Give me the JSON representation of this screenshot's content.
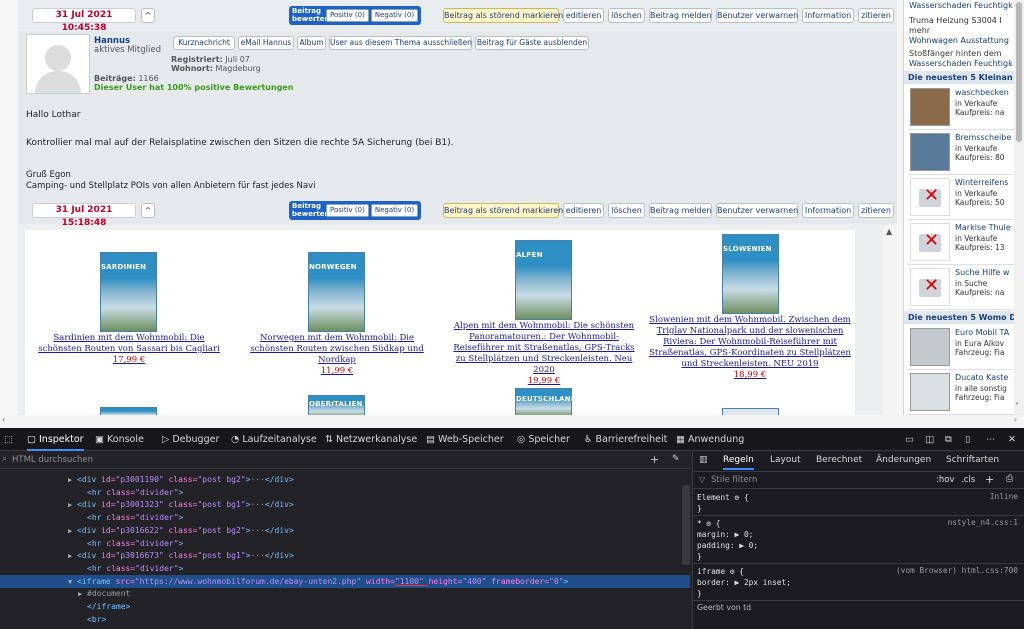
{
  "post1_bar": {
    "date": "31 Jul 2021 10:45:38",
    "up": "^",
    "rate_label": "Beitrag bewerten:",
    "positive": "Positiv (0)",
    "negative": "Negativ (0)",
    "actions": [
      "Beitrag als störend markieren",
      "editieren",
      "löschen",
      "Beitrag melden",
      "Benutzer verwarnen",
      "Information",
      "zitieren"
    ]
  },
  "post2": {
    "user": "Hannus",
    "role": "aktives Mitglied",
    "user_buttons": [
      "Kurznachricht",
      "eMail Hannus",
      "Album",
      "User aus diesem Thema ausschließen",
      "Beitrag für Gäste ausblenden"
    ],
    "registered_label": "Registriert:",
    "registered": "Juli 07",
    "location_label": "Wohnort:",
    "location": "Magdeburg",
    "posts_label": "Beiträge:",
    "posts": "1166",
    "rating": "Dieser User hat 100% positive Bewertungen",
    "body": [
      "Hallo Lothar",
      "Kontrollier mal mal auf der Relaisplatine zwischen den Sitzen die rechte 5A Sicherung (bei B1).",
      "Gruß Egon",
      "Camping- und Stellplatz POIs von allen Anbietern für fast jedes Navi"
    ]
  },
  "post2_bar": {
    "date": "31 Jul 2021 15:18:48",
    "up": "^",
    "rate_label": "Beitrag bewerten:",
    "positive": "Positiv (0)",
    "negative": "Negativ (0)",
    "actions": [
      "Beitrag als störend markieren",
      "editieren",
      "löschen",
      "Beitrag melden",
      "Benutzer verwarnen",
      "Information",
      "zitieren"
    ]
  },
  "ad": {
    "books": [
      {
        "cover": "SARDINIEN",
        "title": "Sardinien mit dem Wohnmobil: Die schönsten Routen von Sassari bis Cagliari",
        "price": "17,99 €"
      },
      {
        "cover": "NORWEGEN",
        "title": "Norwegen mit dem Wohnmobil: Die schönsten Routen zwischen Südkap und Nordkap",
        "price": "11,99 €"
      },
      {
        "cover": "ALPEN",
        "title": "Alpen mit dem Wohnmobil: Die schönsten Panoramatouren.: Der Wohnmobil-Reiseführer mit Straßenatlas, GPS-Tracks zu Stellplätzen und Streckenleisten. Neu 2020",
        "price": "19,99 €"
      },
      {
        "cover": "SLOWENIEN",
        "title": "Slowenien mit dem Wohnmobil. Zwischen dem Triglav Nationalpark und der slowenischen Riviera: Der Wohnmobil-Reiseführer mit Straßenatlas, GPS-Koordinaten zu Stellplätzen und Streckenleisten. NEU 2019",
        "price": "18,99 €"
      }
    ],
    "covers_row2": [
      "OBERITALIEN",
      "DEUTSCHLAND"
    ]
  },
  "sidebar": {
    "top": [
      "Wasserschaden Feuchtigk",
      "Truma Heizung S3004 I",
      "mehr",
      "Wohnwagen Ausstattung",
      "Stoßfänger hinten dem",
      "Wasserschaden Feuchtigk"
    ],
    "kleinanz_head": "Die neuesten 5 Kleinan",
    "kleinanz": [
      {
        "t1": "waschbecken",
        "t2": "in Verkaufe",
        "t3": "Kaufpreis: na"
      },
      {
        "t1": "Bremsscheibe",
        "t2": "in Verkaufe",
        "t3": "Kaufpreis: 80"
      },
      {
        "t1": "Winterreifens",
        "t2": "in Verkaufe",
        "t3": "Kaufpreis: 50"
      },
      {
        "t1": "Markise Thule",
        "t2": "in Verkaufe",
        "t3": "Kaufpreis: 13"
      },
      {
        "t1": "Suche Hilfe w",
        "t2": "in Suche",
        "t3": "Kaufpreis: na"
      }
    ],
    "womo_head": "Die neuesten 5 Womo D",
    "womo": [
      {
        "t1": "Euro Mobil TA",
        "t2": "in Eura Alkov",
        "t3": "Fahrzeug: Fia"
      },
      {
        "t1": "Ducato Kaste",
        "t2": "in alle sonstig",
        "t3": "Fahrzeug: Fia"
      }
    ]
  },
  "devtools": {
    "tabs": [
      "Inspektor",
      "Konsole",
      "Debugger",
      "Laufzeitanalyse",
      "Netzwerkanalyse",
      "Web-Speicher",
      "Speicher",
      "Barrierefreiheit",
      "Anwendung"
    ],
    "search_placeholder": "HTML durchsuchen",
    "code": [
      {
        "indent": 68,
        "arrow": "▶",
        "parts": [
          [
            "tg",
            "<div "
          ],
          [
            "at",
            "id="
          ],
          [
            "av",
            "\"p3001190\" "
          ],
          [
            "at",
            "class="
          ],
          [
            "av",
            "\"post bg2\""
          ],
          [
            "tg",
            ">"
          ],
          [
            "cm",
            "···"
          ],
          [
            "tg",
            "</div>"
          ]
        ]
      },
      {
        "indent": 78,
        "arrow": "",
        "parts": [
          [
            "tg",
            "<hr "
          ],
          [
            "at",
            "class="
          ],
          [
            "av",
            "\"divider\""
          ],
          [
            "tg",
            ">"
          ]
        ]
      },
      {
        "indent": 68,
        "arrow": "▶",
        "parts": [
          [
            "tg",
            "<div "
          ],
          [
            "at",
            "id="
          ],
          [
            "av",
            "\"p3001323\" "
          ],
          [
            "at",
            "class="
          ],
          [
            "av",
            "\"post bg1\""
          ],
          [
            "tg",
            ">"
          ],
          [
            "cm",
            "···"
          ],
          [
            "tg",
            "</div>"
          ]
        ]
      },
      {
        "indent": 78,
        "arrow": "",
        "parts": [
          [
            "tg",
            "<hr "
          ],
          [
            "at",
            "class="
          ],
          [
            "av",
            "\"divider\""
          ],
          [
            "tg",
            ">"
          ]
        ]
      },
      {
        "indent": 68,
        "arrow": "▶",
        "parts": [
          [
            "tg",
            "<div "
          ],
          [
            "at",
            "id="
          ],
          [
            "av",
            "\"p3016622\" "
          ],
          [
            "at",
            "class="
          ],
          [
            "av",
            "\"post bg2\""
          ],
          [
            "tg",
            ">"
          ],
          [
            "cm",
            "···"
          ],
          [
            "tg",
            "</div>"
          ]
        ]
      },
      {
        "indent": 78,
        "arrow": "",
        "parts": [
          [
            "tg",
            "<hr "
          ],
          [
            "at",
            "class="
          ],
          [
            "av",
            "\"divider\""
          ],
          [
            "tg",
            ">"
          ]
        ]
      },
      {
        "indent": 68,
        "arrow": "▶",
        "parts": [
          [
            "tg",
            "<div "
          ],
          [
            "at",
            "id="
          ],
          [
            "av",
            "\"p3016673\" "
          ],
          [
            "at",
            "class="
          ],
          [
            "av",
            "\"post bg1\""
          ],
          [
            "tg",
            ">"
          ],
          [
            "cm",
            "···"
          ],
          [
            "tg",
            "</div>"
          ]
        ]
      },
      {
        "indent": 78,
        "arrow": "",
        "parts": [
          [
            "tg",
            "<hr "
          ],
          [
            "at",
            "class="
          ],
          [
            "av",
            "\"divider\""
          ],
          [
            "tg",
            ">"
          ]
        ]
      },
      {
        "indent": 68,
        "arrow": "▼",
        "parts": [
          [
            "tg",
            "<iframe "
          ],
          [
            "at",
            "src="
          ],
          [
            "av",
            "\"https://www.wohnmobilforum.de/ebay-unten2.php\" "
          ],
          [
            "at",
            "width="
          ],
          [
            "av",
            "\"1100\" "
          ],
          [
            "at",
            "height="
          ],
          [
            "av",
            "\"400\" "
          ],
          [
            "at",
            "frameborder="
          ],
          [
            "av",
            "\"0\""
          ],
          [
            "tg",
            ">"
          ]
        ]
      },
      {
        "indent": 78,
        "arrow": "▶",
        "parts": [
          [
            "cm",
            "#document"
          ]
        ]
      },
      {
        "indent": 78,
        "arrow": "",
        "parts": [
          [
            "tg",
            "</iframe>"
          ]
        ]
      },
      {
        "indent": 78,
        "arrow": "",
        "parts": [
          [
            "tg",
            "<br>"
          ]
        ]
      }
    ],
    "rules_tabs": [
      "Regeln",
      "Layout",
      "Berechnet",
      "Änderungen",
      "Schriftarten"
    ],
    "filter_placeholder": "Stile filtern",
    "hov": ":hov",
    "cls": ".cls",
    "rules": [
      {
        "line": "Element ⚙ {",
        "src": "Inline"
      },
      {
        "line": "}",
        "src": ""
      },
      {
        "line": "* ⚙ {",
        "src": "nstyle_n4.css:1"
      },
      {
        "line": "    margin: ▶ 0;",
        "src": ""
      },
      {
        "line": "    padding: ▶ 0;",
        "src": ""
      },
      {
        "line": "}",
        "src": ""
      },
      {
        "line": "iframe ⚙ {",
        "src": "(vom Browser) html.css:700"
      },
      {
        "line": "    border: ▶ 2px inset;",
        "src": ""
      },
      {
        "line": "}",
        "src": ""
      },
      {
        "line": "Geerbt von td",
        "src": ""
      }
    ]
  }
}
